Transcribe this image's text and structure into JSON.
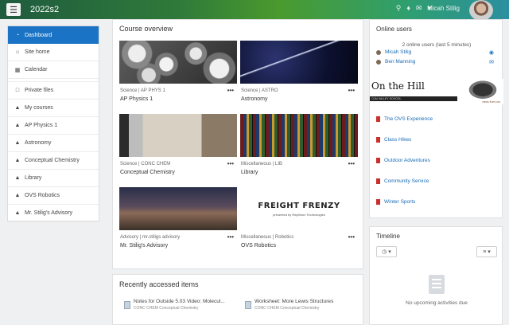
{
  "navbar": {
    "menu_icon": "hamburger-icon",
    "site_name": "2022s2",
    "user_name": "Micah Stilig",
    "icons": [
      "search-icon",
      "bell-icon",
      "chat-icon",
      "chevron-down-icon"
    ]
  },
  "leftnav": {
    "items": [
      {
        "label": "Dashboard",
        "icon": "dashboard-icon"
      },
      {
        "label": "Site home",
        "icon": "home-icon"
      },
      {
        "label": "Calendar",
        "icon": "calendar-icon"
      },
      {
        "label": "Private files",
        "icon": "file-icon"
      },
      {
        "label": "My courses",
        "icon": "graduation-cap-icon"
      },
      {
        "label": "AP Physics 1",
        "icon": "graduation-cap-icon"
      },
      {
        "label": "Astronomy",
        "icon": "graduation-cap-icon"
      },
      {
        "label": "Conceptual Chemistry",
        "icon": "graduation-cap-icon"
      },
      {
        "label": "Library",
        "icon": "graduation-cap-icon"
      },
      {
        "label": "OVS Robotics",
        "icon": "graduation-cap-icon"
      },
      {
        "label": "Mr. Stilig's Advisory",
        "icon": "graduation-cap-icon"
      }
    ]
  },
  "course_overview": {
    "title": "Course overview",
    "courses": [
      {
        "category": "Science | AP PHYS 1",
        "name": "AP Physics 1"
      },
      {
        "category": "Science | ASTRO",
        "name": "Astronomy"
      },
      {
        "category": "Science | CONC CHEM",
        "name": "Conceptual Chemistry"
      },
      {
        "category": "Miscellaneous | LIB",
        "name": "Library"
      },
      {
        "category": "Advisory | mr.stiligs advisory",
        "name": "Mr. Stilig's Advisory"
      },
      {
        "category": "Miscellaneous | Robotics",
        "name": "OVS Robotics"
      }
    ],
    "robotics_logo": {
      "title": "FREIGHT FRENZY",
      "sub": "presented by Raytheon Technologies"
    },
    "menu_glyph": "•••"
  },
  "recent": {
    "title": "Recently accessed items",
    "items": [
      {
        "title": "Notes for Outside 5.03 Video: Molecul...",
        "course": "CONC CHEM Conceptual Chemistry"
      },
      {
        "title": "Worksheet: More Lewis Structures",
        "course": "CONC CHEM Conceptual Chemistry"
      }
    ]
  },
  "online_users": {
    "title": "Online users",
    "count_text": "2 online users (last 5 minutes)",
    "users": [
      {
        "name": "Micah Stilig",
        "icon": "eye-icon"
      },
      {
        "name": "Ben Manning",
        "icon": "message-icon"
      }
    ]
  },
  "on_the_hill": {
    "title": "On the Hill",
    "bar_text": "OJAI VALLEY SCHOOL",
    "foot_text": "news from ovs"
  },
  "links": [
    "The OVS Experience",
    "Class Hikes",
    "Outdoor Adventures",
    "Community Service",
    "Winter Sports"
  ],
  "timeline": {
    "title": "Timeline",
    "filter_icon": "clock-icon",
    "sort_icon": "sort-list-icon",
    "empty_text": "No upcoming activities due"
  }
}
